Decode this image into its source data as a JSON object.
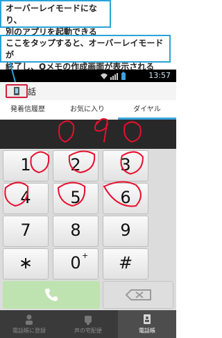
{
  "callouts": {
    "top": {
      "line1": "オーバーレイモードになり、",
      "line2": "別のアプリを起動できる"
    },
    "middle": {
      "line1": "ここをタップすると、オーバーレイモードが",
      "line2": "終了し、Qメモの作成画面が表示される"
    }
  },
  "status_bar": {
    "time": "13:57"
  },
  "app": {
    "title": "話"
  },
  "tabs": [
    {
      "label": "発着信履歴",
      "active": false
    },
    {
      "label": "お気に入り",
      "active": false
    },
    {
      "label": "ダイヤル",
      "active": true
    }
  ],
  "keypad": {
    "keys": [
      {
        "digit": "1"
      },
      {
        "digit": "2"
      },
      {
        "digit": "3"
      },
      {
        "digit": "4"
      },
      {
        "digit": "5"
      },
      {
        "digit": "6"
      },
      {
        "digit": "7"
      },
      {
        "digit": "8"
      },
      {
        "digit": "9"
      },
      {
        "digit": "∗"
      },
      {
        "digit": "0",
        "sup": "+"
      },
      {
        "digit": "#"
      }
    ]
  },
  "bottom_nav": [
    {
      "label": "電話帳に登録",
      "icon": "add-contact-icon",
      "active": false
    },
    {
      "label": "声の宅配便",
      "icon": "voice-delivery-icon",
      "active": false
    },
    {
      "label": "電話帳",
      "icon": "phonebook-icon",
      "active": true
    }
  ],
  "colors": {
    "callout_border": "#29a3d8",
    "handwriting": "#e8102e",
    "tab_indicator": "#3aa3dd",
    "call_button": "#bfe3b0",
    "highlight_border": "#d21f3c"
  }
}
